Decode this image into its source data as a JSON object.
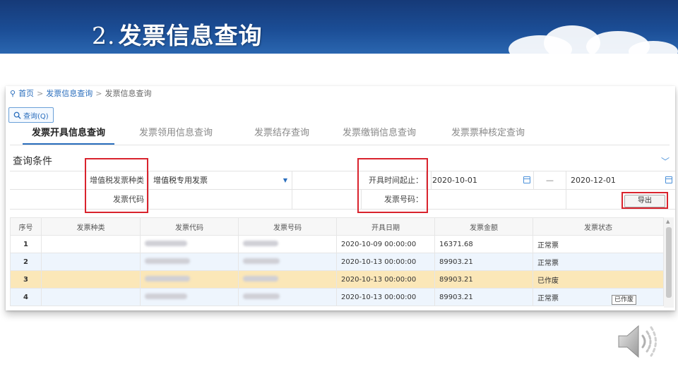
{
  "slide": {
    "number": "2.",
    "title": "发票信息查询"
  },
  "breadcrumb": {
    "home": "首页",
    "level1": "发票信息查询",
    "current": "发票信息查询",
    "separator": ">"
  },
  "query_button": {
    "label": "查询(Q)",
    "icon": "search-icon"
  },
  "tabs": [
    {
      "label": "发票开具信息查询",
      "active": true
    },
    {
      "label": "发票领用信息查询",
      "active": false
    },
    {
      "label": "发票结存查询",
      "active": false
    },
    {
      "label": "发票缴销信息查询",
      "active": false
    },
    {
      "label": "发票票种核定查询",
      "active": false
    }
  ],
  "conditions": {
    "title": "查询条件",
    "invoice_type_label": "增值税发票种类",
    "invoice_type_value": "增值税专用发票",
    "invoice_code_label": "发票代码",
    "date_range_label": "开具时间起止：",
    "date_from": "2020-10-01",
    "date_sep": "—",
    "date_to": "2020-12-01",
    "invoice_no_label": "发票号码：",
    "export_label": "导出"
  },
  "table": {
    "headers": [
      "序号",
      "发票种类",
      "发票代码",
      "发票号码",
      "开具日期",
      "发票金额",
      "发票状态"
    ],
    "rows": [
      {
        "idx": "1",
        "date": "2020-10-09 00:00:00",
        "amount": "16371.68",
        "status": "正常票"
      },
      {
        "idx": "2",
        "date": "2020-10-13 00:00:00",
        "amount": "89903.21",
        "status": "正常票"
      },
      {
        "idx": "3",
        "date": "2020-10-13 00:00:00",
        "amount": "89903.21",
        "status": "已作废"
      },
      {
        "idx": "4",
        "date": "2020-10-13 00:00:00",
        "amount": "89903.21",
        "status": "正常票"
      }
    ],
    "tooltip": "已作废"
  },
  "colors": {
    "banner": "#1b4d95",
    "accent": "#2a6ebd",
    "highlight_box": "#d9232d",
    "selected_row": "#fbe7b8",
    "alt_row": "#eef5fd"
  },
  "audio_icon": "speaker-icon"
}
